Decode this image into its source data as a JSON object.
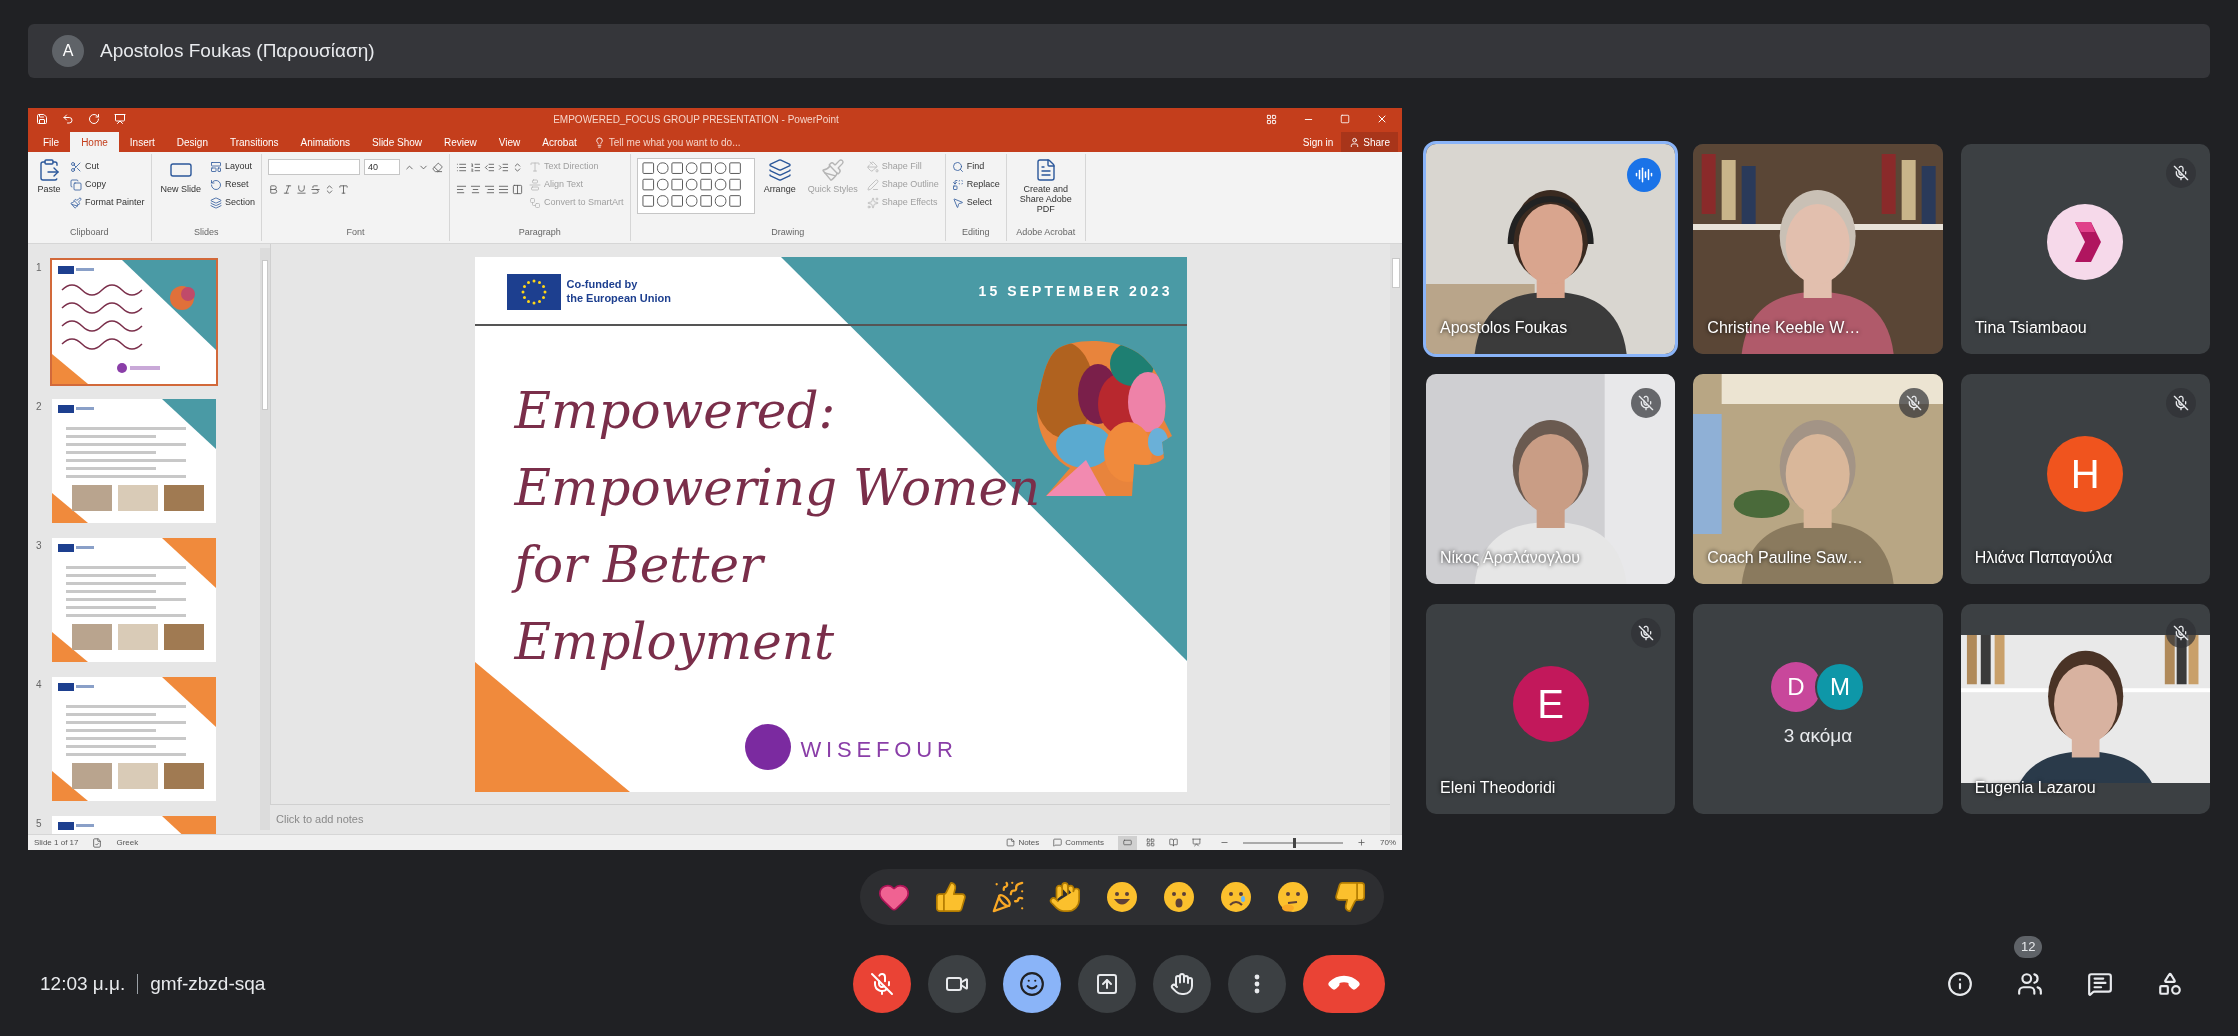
{
  "top_bar": {
    "avatar": "A",
    "title": "Apostolos Foukas (Παρουσίαση)"
  },
  "presentation": {
    "title": "EMPOWERED_FOCUS GROUP PRESENTATION - PowerPoint",
    "tabs": [
      {
        "label": "File",
        "selected": false
      },
      {
        "label": "Home",
        "selected": true
      },
      {
        "label": "Insert",
        "selected": false
      },
      {
        "label": "Design",
        "selected": false
      },
      {
        "label": "Transitions",
        "selected": false
      },
      {
        "label": "Animations",
        "selected": false
      },
      {
        "label": "Slide Show",
        "selected": false
      },
      {
        "label": "Review",
        "selected": false
      },
      {
        "label": "View",
        "selected": false
      },
      {
        "label": "Acrobat",
        "selected": false
      }
    ],
    "tell_me": "Tell me what you want to do...",
    "sign_in": "Sign in",
    "share": "Share",
    "ribbon_groups": [
      {
        "kind": "buttons",
        "label": "Clipboard",
        "items": [
          {
            "kind": "large",
            "label": "Paste",
            "disabled": false
          },
          {
            "kind": "small",
            "label": "Cut",
            "disabled": false
          },
          {
            "kind": "small",
            "label": "Copy",
            "disabled": false
          },
          {
            "kind": "small",
            "label": "Format Painter",
            "disabled": false
          }
        ]
      },
      {
        "kind": "buttons",
        "label": "Slides",
        "items": [
          {
            "kind": "large",
            "label": "New Slide",
            "disabled": false
          },
          {
            "kind": "small",
            "label": "Layout",
            "disabled": false
          },
          {
            "kind": "small",
            "label": "Reset",
            "disabled": false
          },
          {
            "kind": "small",
            "label": "Section",
            "disabled": false
          }
        ]
      },
      {
        "kind": "font",
        "label": "Font",
        "font_size": "40"
      },
      {
        "kind": "paragraph",
        "label": "Paragraph",
        "items": [
          {
            "kind": "small",
            "label": "Text Direction",
            "disabled": true
          },
          {
            "kind": "small",
            "label": "Align Text",
            "disabled": true
          },
          {
            "kind": "small",
            "label": "Convert to SmartArt",
            "disabled": true
          }
        ]
      },
      {
        "kind": "drawing",
        "label": "Drawing",
        "items": [
          {
            "kind": "large",
            "label": "Arrange",
            "disabled": false
          },
          {
            "kind": "large",
            "label": "Quick Styles",
            "disabled": true
          },
          {
            "kind": "small",
            "label": "Shape Fill",
            "disabled": true
          },
          {
            "kind": "small",
            "label": "Shape Outline",
            "disabled": true
          },
          {
            "kind": "small",
            "label": "Shape Effects",
            "disabled": true
          }
        ]
      },
      {
        "kind": "buttons",
        "label": "Editing",
        "items": [
          {
            "kind": "small",
            "label": "Find",
            "disabled": false
          },
          {
            "kind": "small",
            "label": "Replace",
            "disabled": false
          },
          {
            "kind": "small",
            "label": "Select",
            "disabled": false
          }
        ]
      },
      {
        "kind": "buttons",
        "label": "Adobe Acrobat",
        "items": [
          {
            "kind": "large",
            "label": "Create and Share Adobe PDF",
            "disabled": false
          }
        ]
      }
    ],
    "thumbnails": [
      {
        "number": "1",
        "selected": true,
        "color": "#4a9aa5"
      },
      {
        "number": "2",
        "selected": false,
        "color": "#4a9aa5"
      },
      {
        "number": "3",
        "selected": false,
        "color": "#f08a3c"
      },
      {
        "number": "4",
        "selected": false,
        "color": "#f08a3c"
      },
      {
        "number": "5",
        "selected": false,
        "color": "#f08a3c"
      }
    ],
    "slide": {
      "funded_lines": [
        "Co-funded by",
        "the European Union"
      ],
      "date": "15 SEPTEMBER 2023",
      "title_lines": [
        "Empowered:",
        "Empowering Women",
        "for Better",
        "Employment"
      ],
      "logo": "WISEFOUR"
    },
    "notes_placeholder": "Click to add notes",
    "status": {
      "slide": "Slide 1 of 17",
      "language": "Greek",
      "notes": "Notes",
      "comments": "Comments",
      "views": [
        {
          "selected": true
        },
        {
          "selected": false
        },
        {
          "selected": false
        },
        {
          "selected": false
        }
      ],
      "zoom": {
        "level": 0.5
      },
      "zoom_text": "70%"
    }
  },
  "participants": [
    {
      "kind": "video",
      "name": "Apostolos Foukas",
      "muted": false,
      "speaking": true
    },
    {
      "kind": "video",
      "name": "Christine Keeble W…",
      "muted": false,
      "speaking": false
    },
    {
      "kind": "logo",
      "name": "Tina Tsiambaou",
      "muted": true,
      "speaking": false,
      "color": "#f6d9ea"
    },
    {
      "kind": "video",
      "name": "Νίκος Αρσλάνογλου",
      "muted": true,
      "speaking": false
    },
    {
      "kind": "video",
      "name": "Coach Pauline Saw…",
      "muted": true,
      "speaking": false
    },
    {
      "kind": "avatar",
      "name": "Ηλιάνα Παπαγούλα",
      "initial": "H",
      "color": "#f0541e",
      "muted": true,
      "speaking": false
    },
    {
      "kind": "avatar",
      "name": "Eleni Theodoridi",
      "initial": "E",
      "color": "#c2185b",
      "muted": true,
      "speaking": false
    },
    {
      "kind": "more",
      "label": "3 ακόμα",
      "avatars": [
        {
          "initial": "D",
          "color": "#c8479b"
        },
        {
          "initial": "M",
          "color": "#0e97a8"
        }
      ],
      "muted": false,
      "speaking": false
    },
    {
      "kind": "video",
      "name": "Eugenia Lazarou",
      "muted": true,
      "speaking": false
    }
  ],
  "reactions": [
    {
      "kind": "heart"
    },
    {
      "kind": "thumbs_up"
    },
    {
      "kind": "party"
    },
    {
      "kind": "clap"
    },
    {
      "kind": "laugh"
    },
    {
      "kind": "surprised"
    },
    {
      "kind": "sad"
    },
    {
      "kind": "thinking"
    },
    {
      "kind": "thumbs_down"
    }
  ],
  "meeting": {
    "time": "12:03 μ.μ.",
    "code": "gmf-zbzd-sqa"
  },
  "controls": [
    {
      "kind": "mic",
      "highlighted": true
    },
    {
      "kind": "camera",
      "highlighted": false
    },
    {
      "kind": "reactions",
      "highlighted": true
    },
    {
      "kind": "present",
      "highlighted": false
    },
    {
      "kind": "hand",
      "highlighted": false
    },
    {
      "kind": "more",
      "highlighted": false
    },
    {
      "kind": "end"
    }
  ],
  "side_buttons": [
    {
      "kind": "info"
    },
    {
      "kind": "people",
      "badge": "12"
    },
    {
      "kind": "chat"
    },
    {
      "kind": "activities"
    }
  ]
}
